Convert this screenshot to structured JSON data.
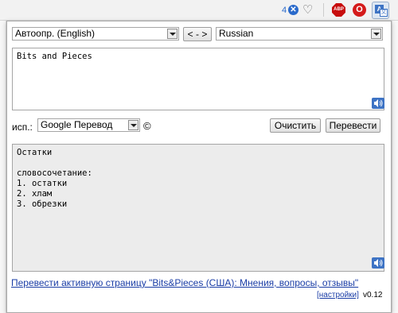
{
  "toolbar": {
    "badge_count": "4",
    "badge_glyph": "✕",
    "heart_glyph": "♡",
    "abp_label": "ABP",
    "opera_glyph": "O",
    "translate_a": "A",
    "translate_b": "文"
  },
  "source_lang": "Автоопр. (English)",
  "swap_button": "< - >",
  "target_lang": "Russian",
  "input_text": "Bits and Pieces",
  "engine_label": "исп.:",
  "engine_value": "Google Перевод",
  "copyright_symbol": "©",
  "clear_button": "Очистить",
  "translate_button": "Перевести",
  "output_text": "Остатки\n\nсловосочетание:\n1. остатки\n2. хлам\n3. обрезки",
  "translate_page_link": "Перевести активную страницу \"Bits&Pieces (США): Мнения, вопросы, отзывы\"",
  "settings_link": "[настройки]",
  "version": "v0.12",
  "colors": {
    "accent": "#3d73c4",
    "link": "#1a3da6",
    "output_bg": "#ececec"
  }
}
